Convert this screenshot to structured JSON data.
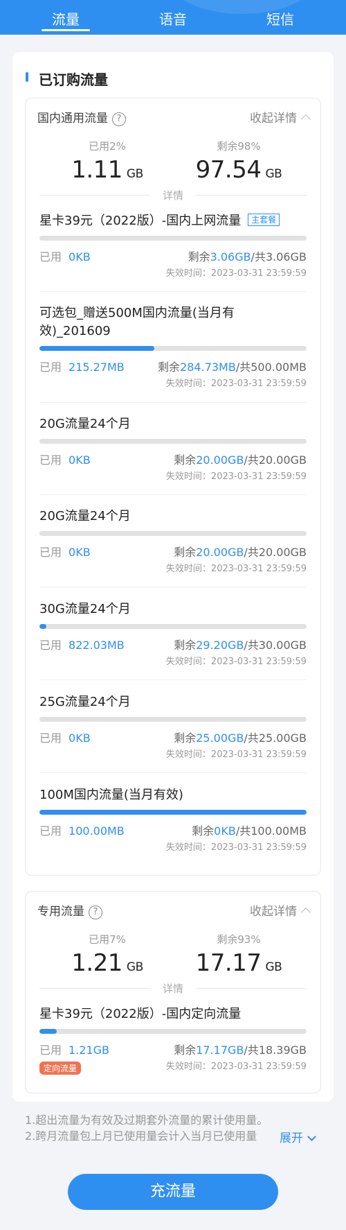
{
  "tabs": [
    {
      "label": "流量",
      "active": true
    },
    {
      "label": "语音",
      "active": false
    },
    {
      "label": "短信",
      "active": false
    }
  ],
  "section": {
    "title": "已订购流量"
  },
  "domestic": {
    "name": "国内通用流量",
    "collapse_label": "收起详情",
    "used_label": "已用2%",
    "used_value": "1.11",
    "used_unit": "GB",
    "left_label": "剩余98%",
    "left_value": "97.54",
    "left_unit": "GB",
    "detail_label": "详情",
    "items": [
      {
        "name": "星卡39元（2022版）-国内上网流量",
        "badge": "主套餐",
        "used_label": "已用",
        "used": "0KB",
        "rem_prefix": "剩余",
        "remaining": "3.06GB",
        "total": "/共3.06GB",
        "expire": "失效时间：2023-03-31 23:59:59",
        "progress": 0
      },
      {
        "name": "可选包_赠送500M国内流量(当月有效)_201609",
        "used_label": "已用",
        "used": "215.27MB",
        "rem_prefix": "剩余",
        "remaining": "284.73MB",
        "total": "/共500.00MB",
        "expire": "失效时间：2023-03-31 23:59:59",
        "progress": 0.43
      },
      {
        "name": "20G流量24个月",
        "used_label": "已用",
        "used": "0KB",
        "rem_prefix": "剩余",
        "remaining": "20.00GB",
        "total": "/共20.00GB",
        "expire": "失效时间：2023-03-31 23:59:59",
        "progress": 0
      },
      {
        "name": "20G流量24个月",
        "used_label": "已用",
        "used": "0KB",
        "rem_prefix": "剩余",
        "remaining": "20.00GB",
        "total": "/共20.00GB",
        "expire": "失效时间：2023-03-31 23:59:59",
        "progress": 0
      },
      {
        "name": "30G流量24个月",
        "used_label": "已用",
        "used": "822.03MB",
        "rem_prefix": "剩余",
        "remaining": "29.20GB",
        "total": "/共30.00GB",
        "expire": "失效时间：2023-03-31 23:59:59",
        "progress": 0.027
      },
      {
        "name": "25G流量24个月",
        "used_label": "已用",
        "used": "0KB",
        "rem_prefix": "剩余",
        "remaining": "25.00GB",
        "total": "/共25.00GB",
        "expire": "失效时间：2023-03-31 23:59:59",
        "progress": 0
      },
      {
        "name": "100M国内流量(当月有效)",
        "used_label": "已用",
        "used": "100.00MB",
        "rem_prefix": "剩余",
        "remaining": "0KB",
        "total": "/共100.00MB",
        "expire": "失效时间：2023-03-31 23:59:59",
        "progress": 1.0
      }
    ]
  },
  "special": {
    "name": "专用流量",
    "collapse_label": "收起详情",
    "used_label": "已用7%",
    "used_value": "1.21",
    "used_unit": "GB",
    "left_label": "剩余93%",
    "left_value": "17.17",
    "left_unit": "GB",
    "detail_label": "详情",
    "items": [
      {
        "name": "星卡39元（2022版）-国内定向流量",
        "tag": "定向流量",
        "used_label": "已用",
        "used": "1.21GB",
        "rem_prefix": "剩余",
        "remaining": "17.17GB",
        "total": "/共18.39GB",
        "expire": "失效时间：2023-03-31 23:59:59",
        "progress": 0.066
      }
    ]
  },
  "notes": {
    "line1": "1.超出流量为有效及过期套外流量的累计使用量。",
    "line2": "2.跨月流量包上月已使用量会计入当月已使用量",
    "expand_label": "展开"
  },
  "cta": {
    "label": "充流量"
  },
  "colors": {
    "accent": "#2f8ff0",
    "tag": "#f0734f"
  },
  "icons": [
    "help-icon",
    "chevron-up-icon",
    "chevron-down-icon"
  ]
}
